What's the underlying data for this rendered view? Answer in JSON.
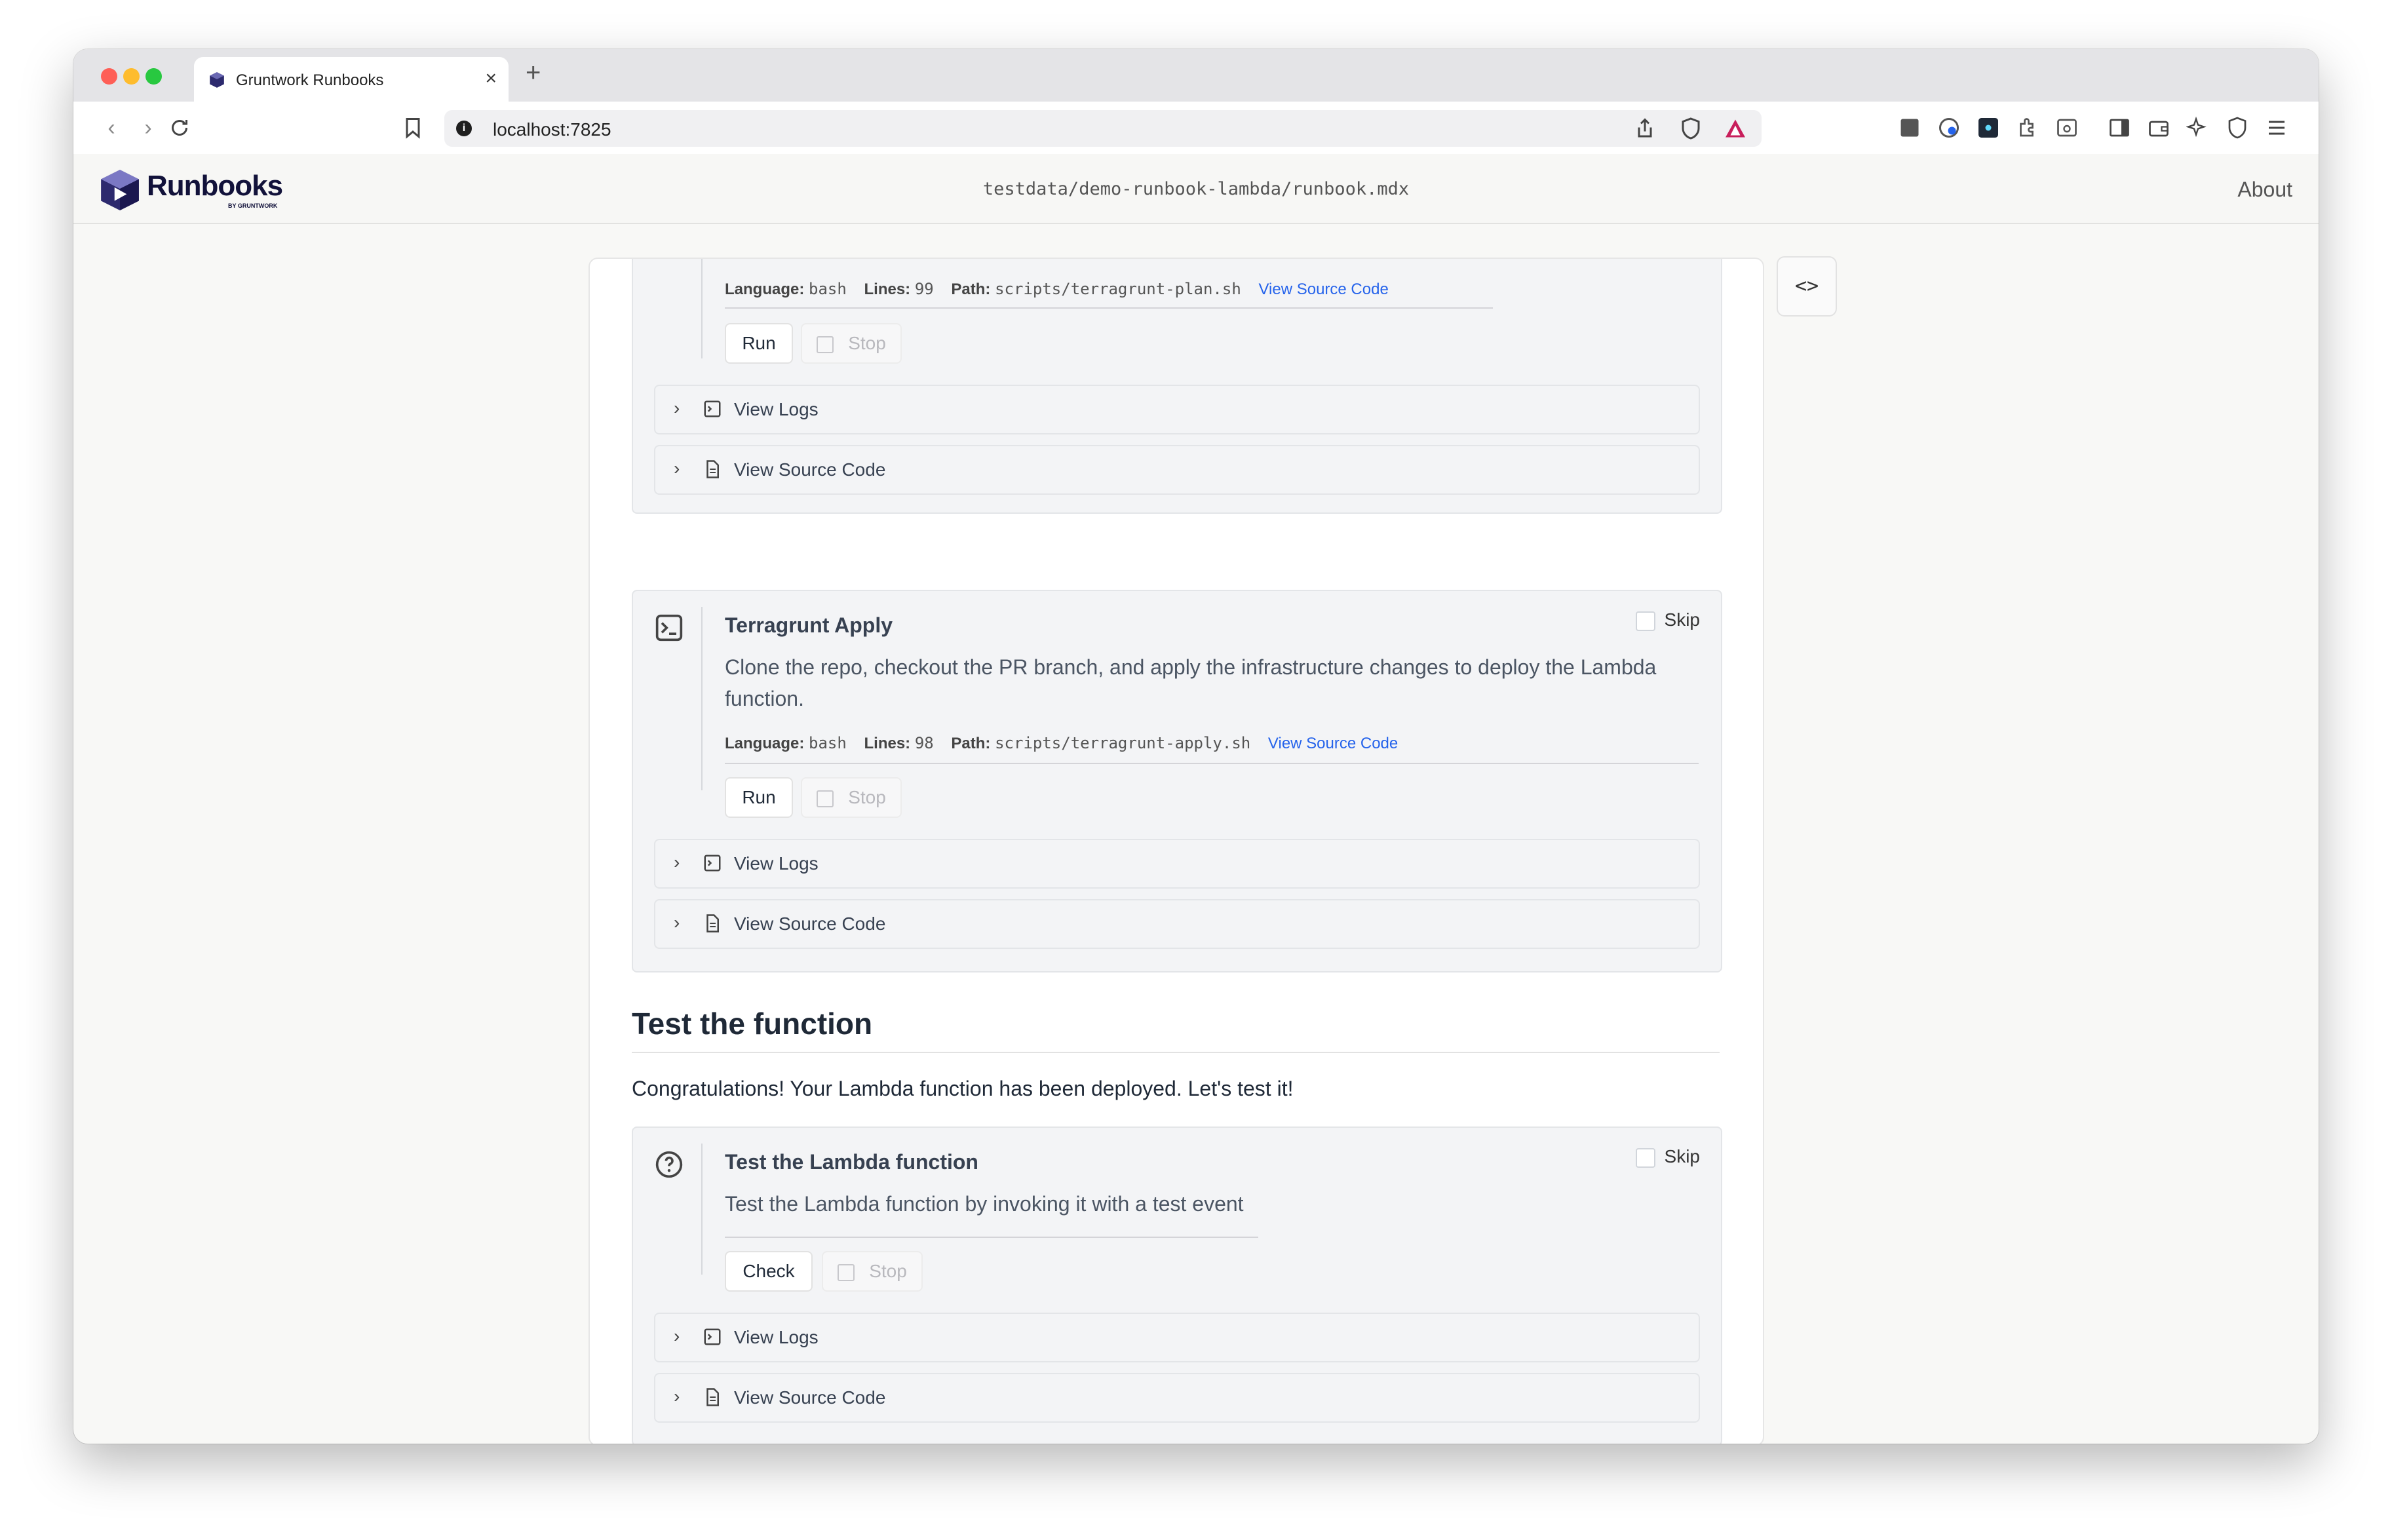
{
  "browser": {
    "tab_title": "Gruntwork Runbooks",
    "url": "localhost:7825"
  },
  "header": {
    "logo": "Runbooks",
    "logo_sub": "BY GRUNTWORK",
    "path": "testdata/demo-runbook-lambda/runbook.mdx",
    "about": "About"
  },
  "blocks": [
    {
      "meta": {
        "language_label": "Language:",
        "language": "bash",
        "lines_label": "Lines:",
        "lines": "99",
        "path_label": "Path:",
        "path": "scripts/terragrunt-plan.sh",
        "view_link": "View Source Code"
      },
      "run": "Run",
      "stop": "Stop",
      "logs": "View Logs",
      "source": "View Source Code"
    },
    {
      "title": "Terragrunt Apply",
      "skip": "Skip",
      "description": "Clone the repo, checkout the PR branch, and apply the infrastructure changes to deploy the Lambda function.",
      "meta": {
        "language_label": "Language:",
        "language": "bash",
        "lines_label": "Lines:",
        "lines": "98",
        "path_label": "Path:",
        "path": "scripts/terragrunt-apply.sh",
        "view_link": "View Source Code"
      },
      "run": "Run",
      "stop": "Stop",
      "logs": "View Logs",
      "source": "View Source Code"
    }
  ],
  "section": {
    "title": "Test the function",
    "body": "Congratulations! Your Lambda function has been deployed. Let's test it!"
  },
  "check_block": {
    "title": "Test the Lambda function",
    "skip": "Skip",
    "description": "Test the Lambda function by invoking it with a test event",
    "check": "Check",
    "stop": "Stop",
    "logs": "View Logs",
    "source": "View Source Code"
  },
  "colors": {
    "accent_link": "#2563eb",
    "block_bg": "#f3f4f6",
    "brand": "#12123a"
  },
  "icons": [
    "back-icon",
    "forward-icon",
    "reload-icon",
    "bookmark-icon",
    "info-icon",
    "share-icon",
    "shield-icon",
    "code-icon",
    "terminal-icon",
    "question-icon",
    "chevron-right-icon",
    "logs-icon",
    "file-icon"
  ]
}
